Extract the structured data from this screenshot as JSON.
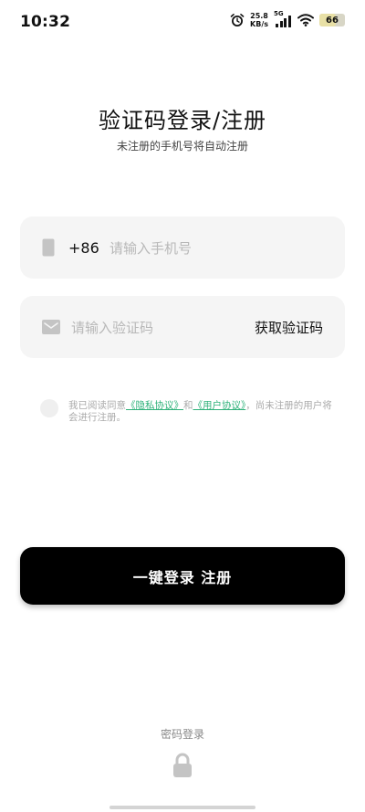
{
  "status_bar": {
    "time": "10:32",
    "net_speed_value": "25.8",
    "net_speed_unit": "KB/s",
    "network_type": "5G",
    "battery_level": "66",
    "battery_fraction": 0.66
  },
  "header": {
    "title": "验证码登录/注册",
    "subtitle": "未注册的手机号将自动注册"
  },
  "phone_field": {
    "country_code": "+86",
    "placeholder": "请输入手机号",
    "icon": "phone-icon"
  },
  "code_field": {
    "placeholder": "请输入验证码",
    "get_code_label": "获取验证码",
    "icon": "mail-icon"
  },
  "agreement": {
    "prefix": "我已阅读同意",
    "privacy_link": "《隐私协议》",
    "and": "和",
    "user_link": "《用户协议》",
    "suffix": "，尚未注册的用户将会进行注册。",
    "link_color": "#2fb27a"
  },
  "login_button": {
    "label": "一键登录 注册"
  },
  "alt_login": {
    "label": "密码登录",
    "icon": "lock-icon"
  }
}
